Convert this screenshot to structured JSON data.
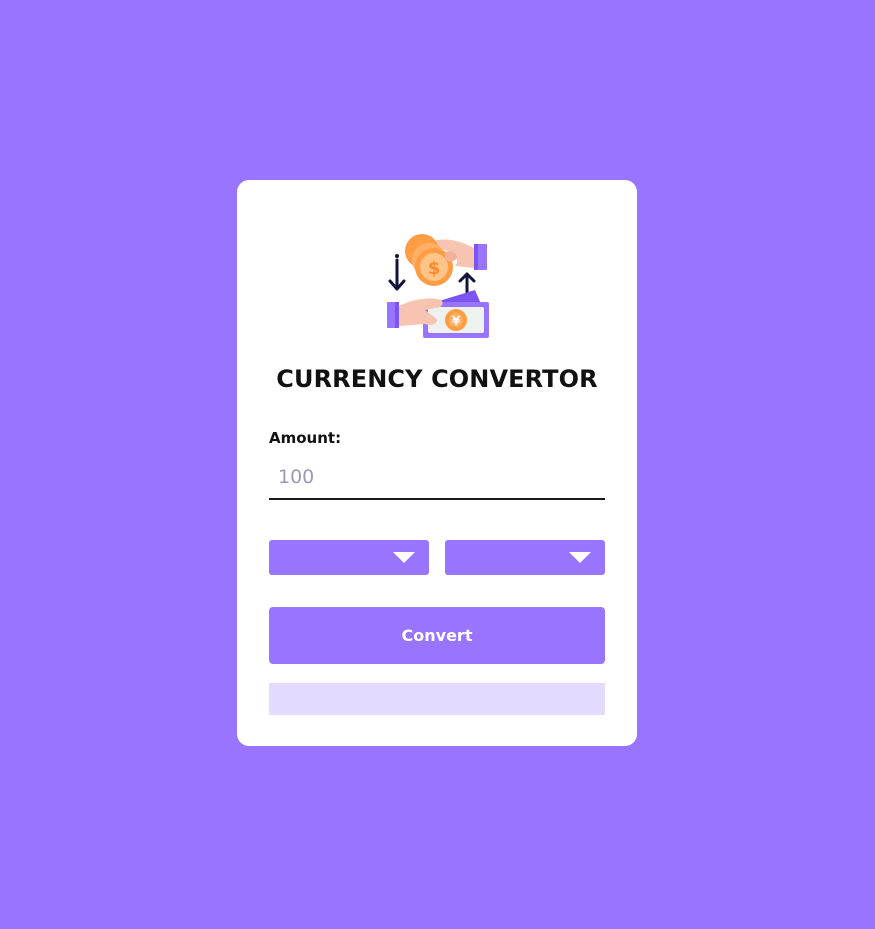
{
  "app": {
    "title": "CURRENCY CONVERTOR"
  },
  "logo": {
    "icon": "currency-exchange-hands-icon"
  },
  "form": {
    "amount_label": "Amount:",
    "amount_value": "100",
    "from_select": {
      "selected": "",
      "icon": "caret-down-icon"
    },
    "to_select": {
      "selected": "",
      "icon": "caret-down-icon"
    },
    "convert_label": "Convert",
    "result_text": ""
  },
  "colors": {
    "background": "#9874ff",
    "accent": "#9874ff",
    "result_bg": "#e4dcff",
    "card": "#ffffff"
  }
}
